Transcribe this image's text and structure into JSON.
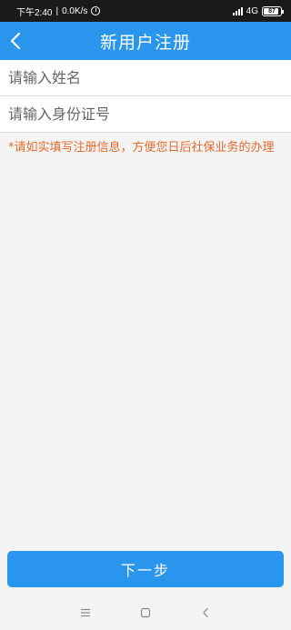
{
  "status_bar": {
    "time": "下午2:40",
    "net_speed": "0.0K/s",
    "network": "4G",
    "battery": "87",
    "battery_level": 0.87
  },
  "header": {
    "title": "新用户注册"
  },
  "form": {
    "name_placeholder": "请输入姓名",
    "id_placeholder": "请输入身份证号",
    "notice": "*请如实填写注册信息，方便您日后社保业务的办理"
  },
  "actions": {
    "next_label": "下一步"
  },
  "colors": {
    "accent": "#2a95ec",
    "notice": "#e8692b",
    "status_bar": "#1a1a1a"
  },
  "icons": {
    "back": "chevron-left-icon",
    "menu": "menu-icon",
    "home": "home-icon",
    "nav_back": "back-icon",
    "alarm": "alarm-icon",
    "signal": "signal-icon"
  }
}
